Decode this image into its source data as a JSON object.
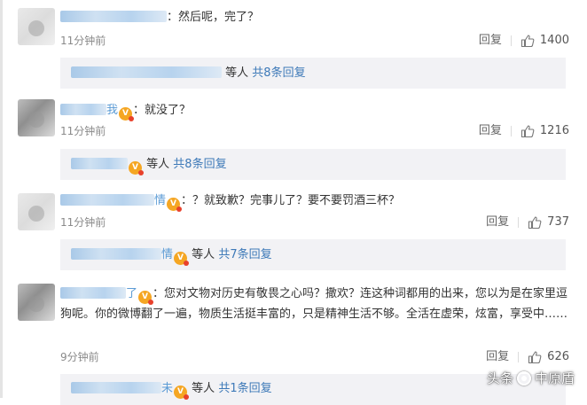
{
  "comments": [
    {
      "name_tail": "",
      "vip": "",
      "content": "：然后呢，完了？",
      "time": "11分钟前",
      "reply_label": "回复",
      "likes": "1400",
      "sub": {
        "suffix": "等人",
        "more": "共8条回复"
      }
    },
    {
      "name_tail": "我",
      "vip": "V",
      "content": "：就没了？",
      "time": "11分钟前",
      "reply_label": "回复",
      "likes": "1216",
      "sub": {
        "suffix": "等人",
        "more": "共8条回复"
      }
    },
    {
      "name_tail": "情",
      "vip": "V",
      "content": "：？就致歉？完事儿了？要不要罚酒三杯？",
      "time": "11分钟前",
      "reply_label": "回复",
      "likes": "737",
      "sub": {
        "name_tail": "情",
        "suffix": "等人",
        "more": "共7条回复"
      }
    },
    {
      "name_tail": "了",
      "vip": "V",
      "content": "：您对文物对历史有敬畏之心吗？撒欢？连这种词都用的出来，您以为是在家里逗狗呢。你的微博翻了一遍，物质生活挺丰富的，只是精神生活不够。全活在虚荣，炫富，享受中……",
      "time": "9分钟前",
      "reply_label": "回复",
      "likes": "626",
      "sub": {
        "name_tail": "未",
        "suffix": "等人",
        "more": "共1条回复"
      }
    }
  ],
  "watermark": {
    "left": "头条",
    "right": "中原盾"
  },
  "colors": {
    "link": "#3d79b8",
    "name": "#5b9bd5",
    "vip": "#f5a623",
    "sub_bg": "#f2f2f5"
  }
}
